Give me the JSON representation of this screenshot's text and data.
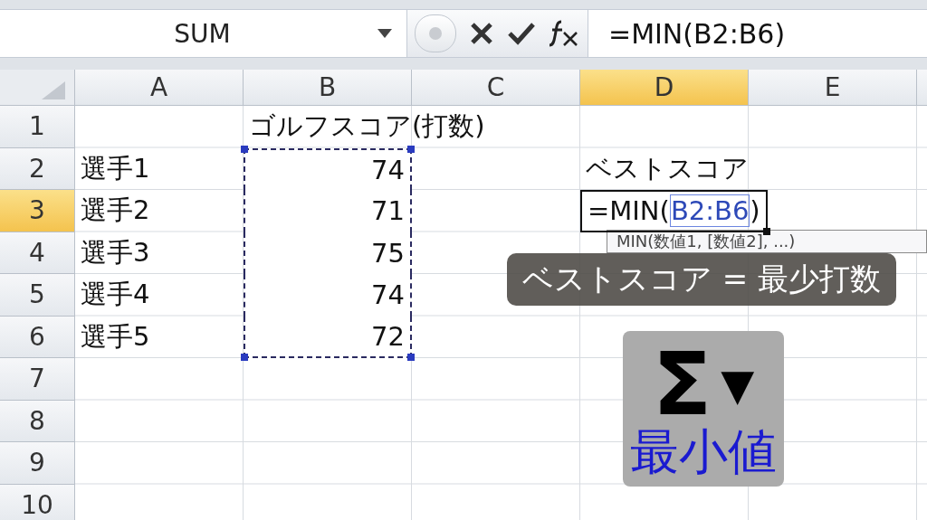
{
  "formula_bar": {
    "name_box": "SUM",
    "formula": "=MIN(B2:B6)"
  },
  "sheet": {
    "columns": [
      {
        "label": "A",
        "selected": false
      },
      {
        "label": "B",
        "selected": false
      },
      {
        "label": "C",
        "selected": false
      },
      {
        "label": "D",
        "selected": true
      },
      {
        "label": "E",
        "selected": false
      }
    ],
    "rows": [
      {
        "label": "1",
        "selected": false,
        "cells": [
          "",
          {
            "kind": "text",
            "text": "ゴルフスコア(打数)"
          },
          "",
          "",
          ""
        ]
      },
      {
        "label": "2",
        "selected": false,
        "cells": [
          {
            "kind": "text",
            "text": "選手1"
          },
          {
            "kind": "number",
            "text": "74",
            "referenced": true
          },
          "",
          {
            "kind": "text",
            "text": "ベストスコア"
          },
          ""
        ]
      },
      {
        "label": "3",
        "selected": true,
        "cells": [
          {
            "kind": "text",
            "text": "選手2"
          },
          {
            "kind": "number",
            "text": "71",
            "referenced": true
          },
          "",
          {
            "kind": "editing",
            "prefix": "=MIN(",
            "reference": "B2:B6",
            "suffix": ")"
          },
          ""
        ]
      },
      {
        "label": "4",
        "selected": false,
        "cells": [
          {
            "kind": "text",
            "text": "選手3"
          },
          {
            "kind": "number",
            "text": "75",
            "referenced": true
          },
          "",
          "",
          ""
        ]
      },
      {
        "label": "5",
        "selected": false,
        "cells": [
          {
            "kind": "text",
            "text": "選手4"
          },
          {
            "kind": "number",
            "text": "74",
            "referenced": true
          },
          "",
          "",
          ""
        ]
      },
      {
        "label": "6",
        "selected": false,
        "cells": [
          {
            "kind": "text",
            "text": "選手5"
          },
          {
            "kind": "number",
            "text": "72",
            "referenced": true
          },
          "",
          "",
          ""
        ]
      },
      {
        "label": "7",
        "selected": false,
        "cells": [
          "",
          "",
          "",
          "",
          ""
        ]
      },
      {
        "label": "8",
        "selected": false,
        "cells": [
          "",
          "",
          "",
          "",
          ""
        ]
      },
      {
        "label": "9",
        "selected": false,
        "cells": [
          "",
          "",
          "",
          "",
          ""
        ]
      },
      {
        "label": "10",
        "selected": false,
        "cells": [
          "",
          "",
          "",
          "",
          ""
        ]
      }
    ]
  },
  "tooltip": "MIN(数値1, [数値2], ...)",
  "caption": "ベストスコア = 最少打数",
  "function_button": {
    "symbol": "Σ",
    "caret": "▼",
    "label": "最小値"
  }
}
